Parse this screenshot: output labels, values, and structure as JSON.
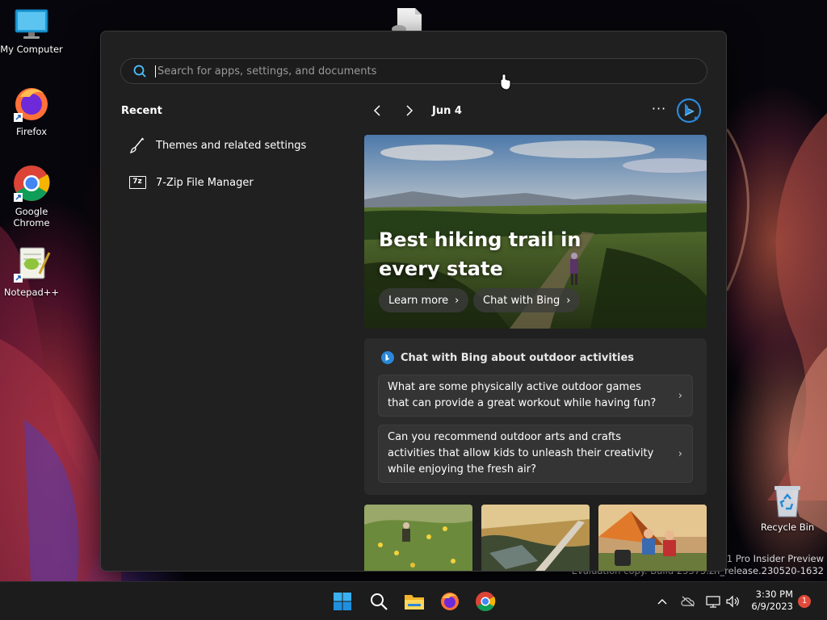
{
  "desktop": {
    "icons": [
      {
        "label": "My Computer",
        "icon": "monitor-icon"
      },
      {
        "label": "Firefox",
        "icon": "firefox-icon"
      },
      {
        "label": "Google Chrome",
        "icon": "chrome-icon"
      },
      {
        "label": "Notepad++",
        "icon": "notepadpp-icon"
      },
      {
        "label": "Recycle Bin",
        "icon": "recycle-bin-icon"
      }
    ],
    "watermark": {
      "line1": "s 11 Pro Insider Preview",
      "line2": "Evaluation copy. Build 25375.zn_release.230520-1632"
    }
  },
  "start": {
    "search": {
      "placeholder": "Search for apps, settings, and documents",
      "value": ""
    },
    "recent": {
      "title": "Recent",
      "items": [
        {
          "label": "Themes and related settings",
          "icon": "brush-icon"
        },
        {
          "label": "7-Zip File Manager",
          "icon": "7zip-icon",
          "icon_text": "7z"
        }
      ]
    },
    "feed": {
      "date": "Jun 4",
      "more_label": "···",
      "hero": {
        "title": "Best hiking trail in every state",
        "learn_more": "Learn more",
        "chat_with_bing": "Chat with Bing"
      },
      "chat_card": {
        "title": "Chat with Bing about outdoor activities",
        "questions": [
          "What are some physically active outdoor games that can provide a great workout while having fun?",
          "Can you recommend outdoor arts and crafts activities that allow kids to unleash their creativity while enjoying the fresh air?"
        ]
      }
    }
  },
  "taskbar": {
    "apps": [
      "windows-start-icon",
      "search-icon",
      "file-explorer-icon",
      "firefox-icon",
      "chrome-icon"
    ],
    "tray": {
      "time": "3:30 PM",
      "date": "6/9/2023",
      "notifications": "1"
    }
  },
  "colors": {
    "panel_bg": "#202020",
    "card_bg": "#2b2b2b",
    "accent_bing": "#2b88d8",
    "notification_badge": "#e04a3a"
  }
}
